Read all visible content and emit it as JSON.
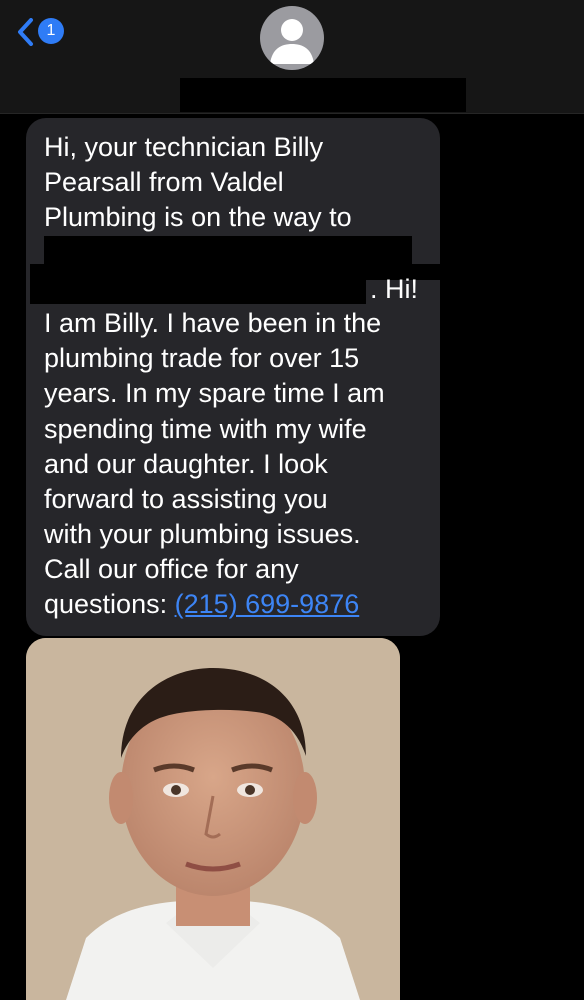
{
  "header": {
    "back_badge_count": "1",
    "icons": {
      "back": "chevron-left-icon",
      "avatar": "person-icon"
    }
  },
  "message": {
    "lines": [
      "Hi, your technician Billy",
      "Pearsall from Valdel",
      "Plumbing is on the way to"
    ],
    "after_redaction": ". Hi!",
    "body_lines": [
      "I am Billy. I have been in the",
      "plumbing trade for over 15",
      "years. In my spare time I am",
      "spending time with my wife",
      "and our daughter. I look",
      "forward to assisting you",
      "with your plumbing issues.",
      "Call our office for any"
    ],
    "last_prefix": "questions: ",
    "phone": "(215) 699-9876"
  },
  "colors": {
    "bubble": "#26262a",
    "link": "#3d85f5",
    "badge": "#2f7cf6"
  }
}
